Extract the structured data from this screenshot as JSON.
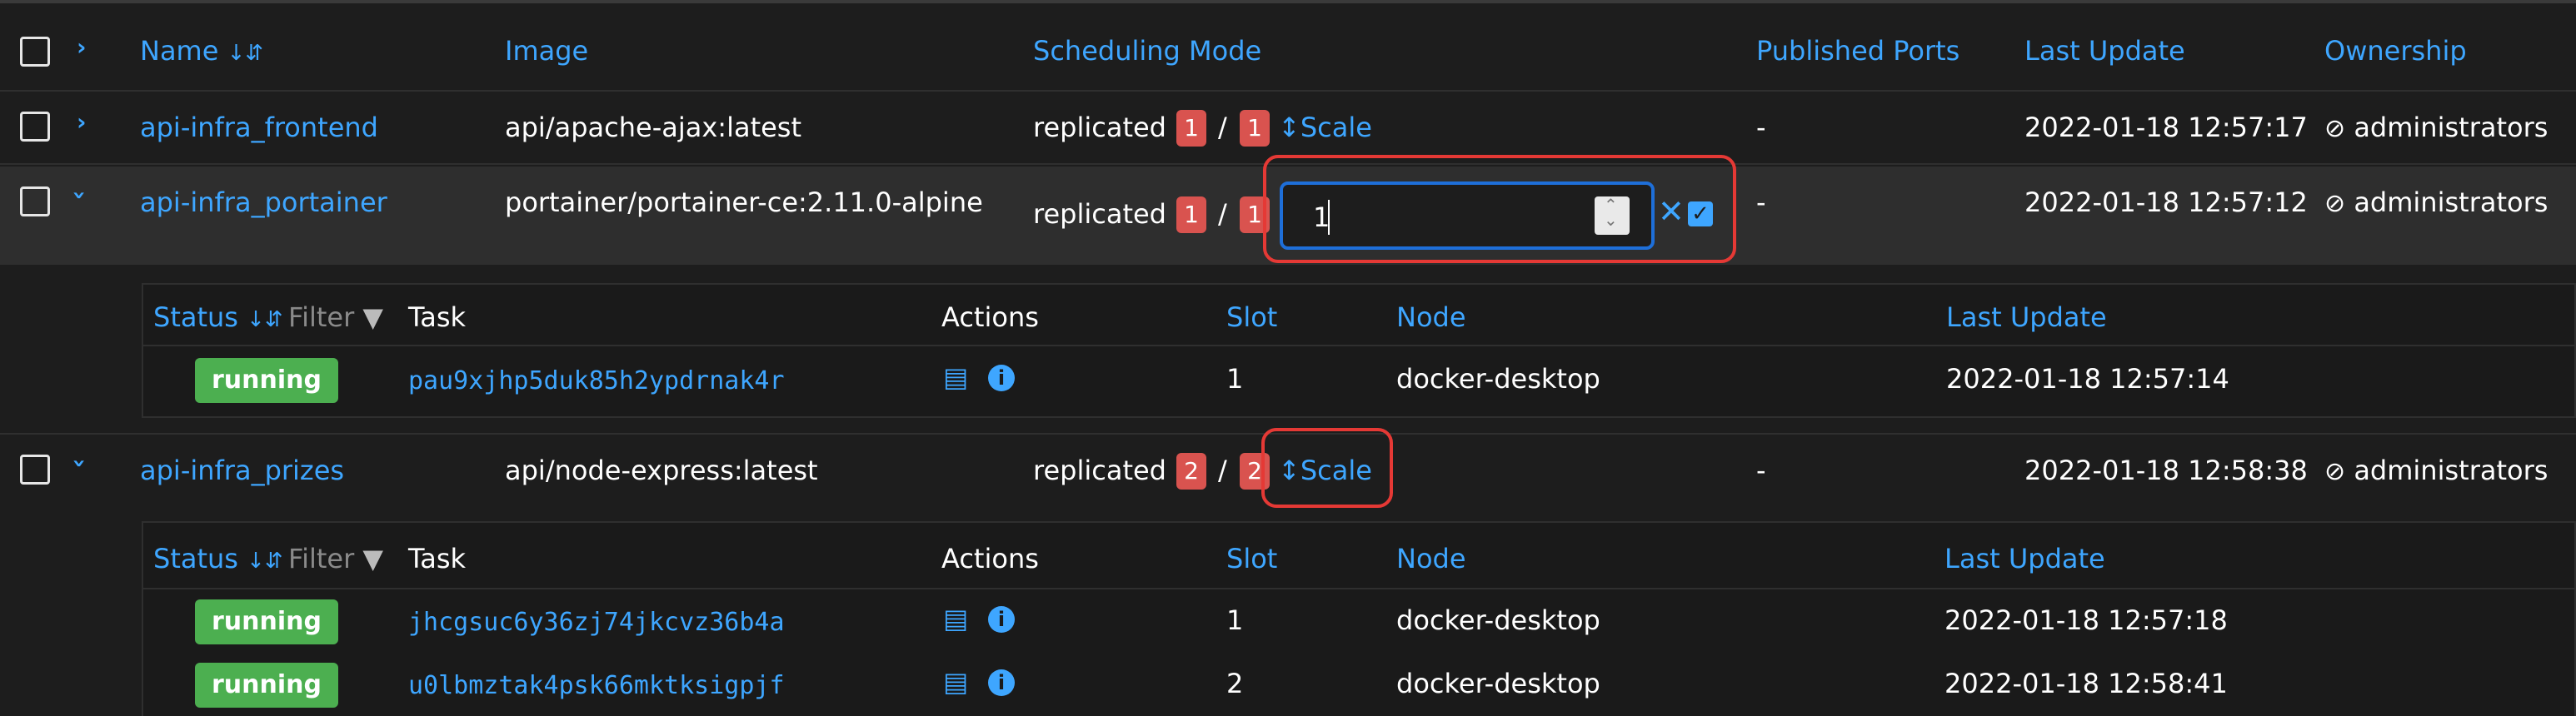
{
  "columns": {
    "name": "Name",
    "image": "Image",
    "scheduling_mode": "Scheduling Mode",
    "published_ports": "Published Ports",
    "last_update": "Last Update",
    "ownership": "Ownership"
  },
  "services": [
    {
      "name": "api-infra_frontend",
      "image": "api/apache-ajax:latest",
      "mode": "replicated",
      "running": "1",
      "desired": "1",
      "scale_label": "Scale",
      "ports": "-",
      "last_update": "2022-01-18 12:57:17",
      "ownership": "administrators"
    },
    {
      "name": "api-infra_portainer",
      "image": "portainer/portainer-ce:2.11.0-alpine",
      "mode": "replicated",
      "running": "1",
      "desired": "1",
      "scale_input_value": "1",
      "ports": "-",
      "last_update": "2022-01-18 12:57:12",
      "ownership": "administrators"
    },
    {
      "name": "api-infra_prizes",
      "image": "api/node-express:latest",
      "mode": "replicated",
      "running": "2",
      "desired": "2",
      "scale_label": "Scale",
      "ports": "-",
      "last_update": "2022-01-18 12:58:38",
      "ownership": "administrators"
    }
  ],
  "task_columns": {
    "status": "Status",
    "filter": "Filter",
    "task": "Task",
    "actions": "Actions",
    "slot": "Slot",
    "node": "Node",
    "last_update": "Last Update"
  },
  "tasks_portainer": [
    {
      "status": "running",
      "task": "pau9xjhp5duk85h2ypdrnak4r",
      "slot": "1",
      "node": "docker-desktop",
      "last_update": "2022-01-18 12:57:14"
    }
  ],
  "tasks_prizes": [
    {
      "status": "running",
      "task": "jhcgsuc6y36zj74jkcvz36b4a",
      "slot": "1",
      "node": "docker-desktop",
      "last_update": "2022-01-18 12:57:18"
    },
    {
      "status": "running",
      "task": "u0lbmztak4psk66mktksigpjf",
      "slot": "2",
      "node": "docker-desktop",
      "last_update": "2022-01-18 12:58:41"
    }
  ],
  "separator": "/",
  "colors": {
    "accent": "#3ea6ff",
    "badge": "#d9534f",
    "running": "#4caf50",
    "highlight": "#e53935"
  }
}
